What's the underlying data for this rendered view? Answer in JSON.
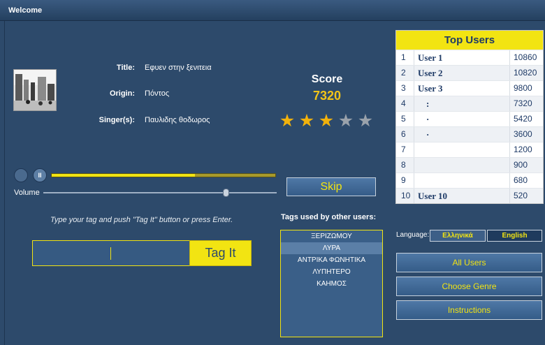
{
  "window": {
    "title": "Welcome"
  },
  "song": {
    "title_label": "Title:",
    "title_value": "Εφυεν στην ξενιτεια",
    "origin_label": "Origin:",
    "origin_value": "Πόντος",
    "singer_label": "Singer(s):",
    "singer_value": "Παυλιδης θοδωρος"
  },
  "score": {
    "label": "Score",
    "value": "7320",
    "stars_filled": 3,
    "stars_total": 5
  },
  "player": {
    "pause_glyph": "II",
    "progress": 0.64,
    "volume_label": "Volume",
    "volume_level": 0.77
  },
  "skip_label": "Skip",
  "tagging": {
    "instructions": "Type your tag and push \"Tag It\" button or press Enter.",
    "input_value": "",
    "button_label": "Tag It"
  },
  "other_tags": {
    "title": "Tags used by other users:",
    "items": [
      "ΞΕΡΙΖΩΜΟΥ",
      "ΛΥΡΑ",
      "ΑΝΤΡΙΚΑ ΦΩΝΗΤΙΚΑ",
      "ΛΥΠΗΤΕΡΟ",
      "ΚΑΗΜΟΣ"
    ],
    "selected_index": 1
  },
  "top_users": {
    "title": "Top Users",
    "rows": [
      {
        "rank": "1",
        "name": "User 1",
        "points": "10860"
      },
      {
        "rank": "2",
        "name": "User 2",
        "points": "10820"
      },
      {
        "rank": "3",
        "name": "User 3",
        "points": "9800"
      },
      {
        "rank": "4",
        "name": ":",
        "points": "7320"
      },
      {
        "rank": "5",
        "name": "·",
        "points": "5420"
      },
      {
        "rank": "6",
        "name": "·",
        "points": "3600"
      },
      {
        "rank": "7",
        "name": "",
        "points": "1200"
      },
      {
        "rank": "8",
        "name": "",
        "points": "900"
      },
      {
        "rank": "9",
        "name": "",
        "points": "680"
      },
      {
        "rank": "10",
        "name": "User 10",
        "points": "520"
      }
    ]
  },
  "language": {
    "label": "Language:",
    "greek": "Ελληνικά",
    "english": "English",
    "selected": "English"
  },
  "side_buttons": {
    "all_users": "All Users",
    "choose_genre": "Choose Genre",
    "instructions": "Instructions"
  },
  "colors": {
    "background": "#2d4a6b",
    "accent": "#f2e412",
    "star_on": "#f2b20c",
    "star_off": "#9aa2ab"
  },
  "icons": {
    "play": "play-icon",
    "pause": "pause-icon",
    "star": "star-icon",
    "thumbnail": "album-photo"
  }
}
